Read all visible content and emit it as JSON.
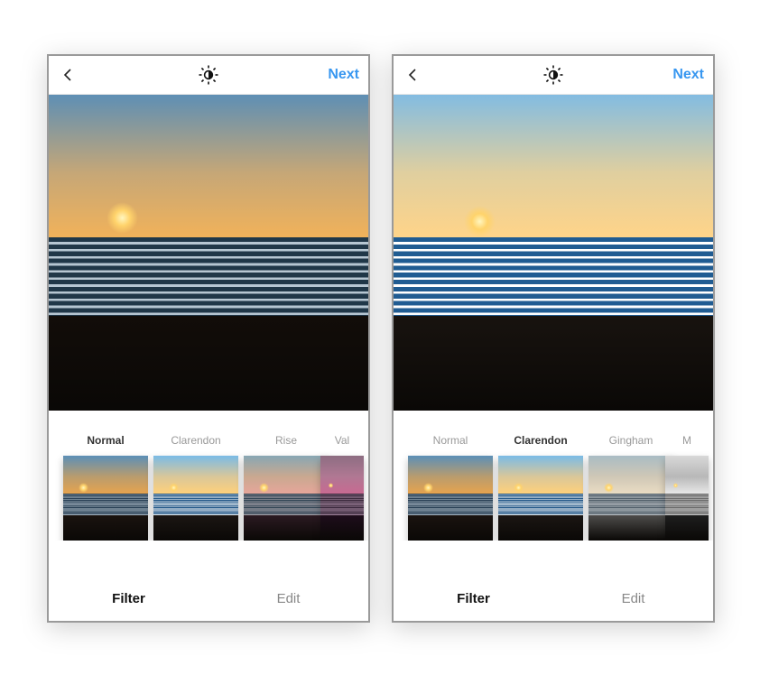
{
  "screens": [
    {
      "header": {
        "next_label": "Next"
      },
      "selected_filter_index": 0,
      "filters": [
        {
          "label": "Normal"
        },
        {
          "label": "Clarendon"
        },
        {
          "label": "Rise"
        },
        {
          "label": "Val",
          "partial": true
        }
      ],
      "tabs": {
        "filter": "Filter",
        "edit": "Edit",
        "active": "filter"
      }
    },
    {
      "header": {
        "next_label": "Next"
      },
      "selected_filter_index": 1,
      "filters": [
        {
          "label": "Normal"
        },
        {
          "label": "Clarendon"
        },
        {
          "label": "Gingham"
        },
        {
          "label": "M",
          "partial": true
        }
      ],
      "tabs": {
        "filter": "Filter",
        "edit": "Edit",
        "active": "filter"
      }
    }
  ],
  "colors": {
    "accent": "#3897f0"
  },
  "icons": {
    "back": "chevron-left",
    "center": "lux-sun"
  },
  "filter_thumb_styles": {
    "Normal": "--sky-top:#5b8fb7;--sky-mid:#b99c6e;--sky-low:#e6a34e;--sea-a:#2c445a;--sea-b:#b9c9d6;--sand:#1a130f;--sea-bright:.95;",
    "Clarendon": "--sky-top:#7abbe6;--sky-mid:#d9c79a;--sky-low:#ffd07a;--sea-a:#214e78;--sea-b:#dceaf6;--sand:#1b1613;--sea-bright:1.15;",
    "Rise": "--sky-top:#88a7b4;--sky-mid:#c9a890;--sky-low:#e6a69a;--sea-a:#3a4e5f;--sea-b:#c9c1c8;--sand:#2b1a22;--sea-bright:.9;",
    "Gingham": "--sky-top:#a9bcc4;--sky-mid:#cfc7b6;--sky-low:#e9dcc3;--sea-a:#5b6b77;--sea-b:#dde2e6;--sand:#4d4c4a;--sea-bright:.9;",
    "Val": "--sky-top:#8d6d82;--sky-mid:#b07893;--sky-low:#c86a92;--sea-a:#3c2b3e;--sea-b:#a88aa3;--sand:#1e0d1b;",
    "M": "--sky-top:#d8d8d8;--sky-mid:#b8b8b8;--sky-low:#e8e8e8;--sea-a:#6b6b6b;--sea-b:#d2d2d2;--sand:#1e1e1e;"
  },
  "preview_styles": {
    "Normal": "--sky-top:#5e8fb4;--sky-mid:#c6a777;--sky-low:#f1b25a;--sea-a:#203748;--sea-b:#b6c6d2;--sand:#120d09;--sun-x:18%;--sun-y:34%;--sun-w:10%;",
    "Clarendon": "--sky-top:#83bce1;--sky-mid:#e0cf9f;--sky-low:#ffd489;--sea-a:#1b4d7a;--sea-b:#e2eef8;--sand:#18130f;--sun-x:22%;--sun-y:35%;--sun-w:10%;--sea-bright:1.2;"
  }
}
